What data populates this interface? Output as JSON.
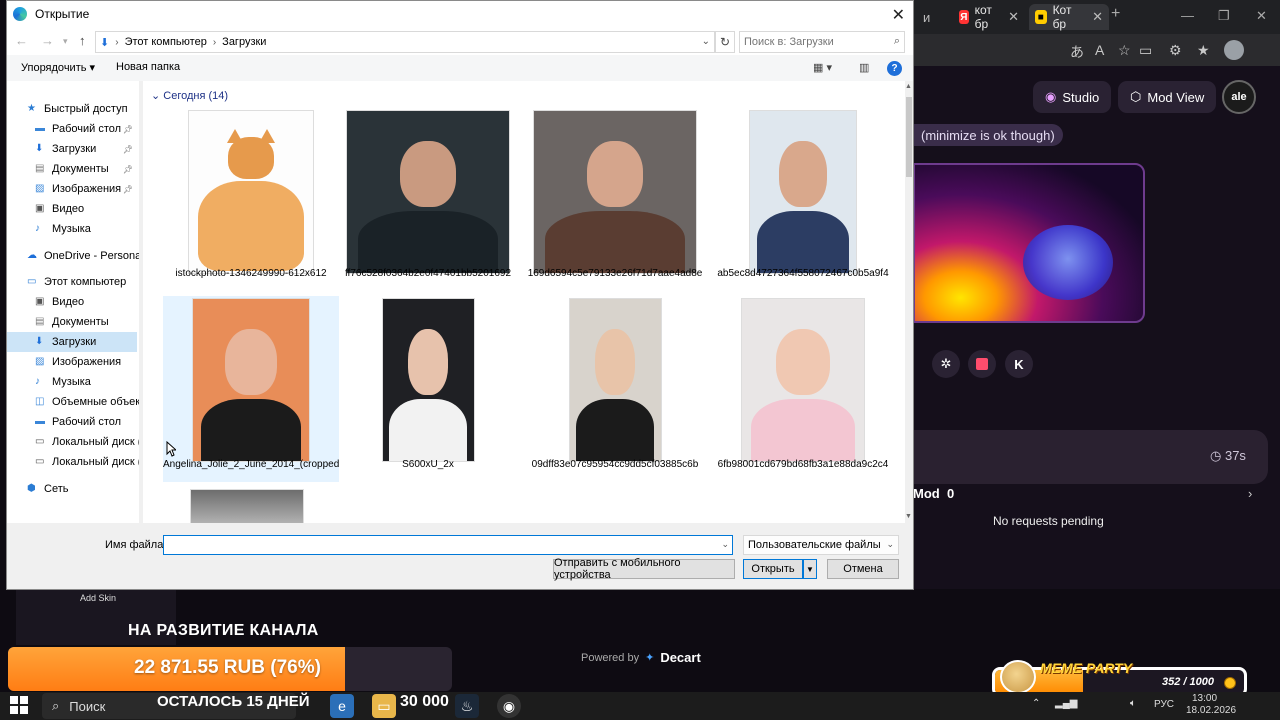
{
  "dialog": {
    "title": "Открытие",
    "breadcrumb": [
      "Этот компьютер",
      "Загрузки"
    ],
    "search_placeholder": "Поиск в: Загрузки",
    "toolbar": {
      "organize": "Упорядочить",
      "new_folder": "Новая папка"
    },
    "group_header": "Сегодня (14)",
    "sidebar": [
      {
        "label": "Быстрый доступ",
        "icon": "star-icon",
        "indent": 0
      },
      {
        "label": "Рабочий стол",
        "icon": "desktop-icon",
        "indent": 1,
        "pinned": true
      },
      {
        "label": "Загрузки",
        "icon": "download-icon",
        "indent": 1,
        "pinned": true
      },
      {
        "label": "Документы",
        "icon": "document-icon",
        "indent": 1,
        "pinned": true
      },
      {
        "label": "Изображения",
        "icon": "images-icon",
        "indent": 1,
        "pinned": true
      },
      {
        "label": "Видео",
        "icon": "video-icon",
        "indent": 1
      },
      {
        "label": "Музыка",
        "icon": "music-icon",
        "indent": 1
      },
      {
        "label": "OneDrive - Personal",
        "icon": "cloud-icon",
        "indent": 0
      },
      {
        "label": "Этот компьютер",
        "icon": "computer-icon",
        "indent": 0
      },
      {
        "label": "Видео",
        "icon": "video-icon",
        "indent": 1
      },
      {
        "label": "Документы",
        "icon": "document-icon",
        "indent": 1
      },
      {
        "label": "Загрузки",
        "icon": "download-icon",
        "indent": 1,
        "selected": true
      },
      {
        "label": "Изображения",
        "icon": "images-icon",
        "indent": 1
      },
      {
        "label": "Музыка",
        "icon": "music-icon",
        "indent": 1
      },
      {
        "label": "Объемные объекты",
        "icon": "cube-icon",
        "indent": 1
      },
      {
        "label": "Рабочий стол",
        "icon": "desktop-icon",
        "indent": 1
      },
      {
        "label": "Локальный диск (C",
        "icon": "drive-icon",
        "indent": 1
      },
      {
        "label": "Локальный диск (D",
        "icon": "drive-icon",
        "indent": 1
      },
      {
        "label": "Сеть",
        "icon": "network-icon",
        "indent": 0
      }
    ],
    "files": [
      {
        "name": "istockphoto-1346249990-612x612",
        "kind": "cat-photo"
      },
      {
        "name": "ff76c528f0364b2e0f47401bb5201692",
        "kind": "portrait-dark"
      },
      {
        "name": "169d6594c5e79133e26f71d7aae4ad8e",
        "kind": "portrait-brown"
      },
      {
        "name": "ab5ec8d4727364f558072467c0b5a9f4",
        "kind": "portrait-blue"
      },
      {
        "name": "Angelina_Jolie_2_June_2014_(cropped)",
        "kind": "portrait-orange",
        "selected": true
      },
      {
        "name": "S600xU_2x",
        "kind": "portrait-darkbg"
      },
      {
        "name": "09dff83e07c95954cc9dd5cf03885c6b",
        "kind": "portrait-blonde"
      },
      {
        "name": "6fb98001cd679bd68fb3a1e88da9c2c4",
        "kind": "portrait-light"
      }
    ],
    "filename_label": "Имя файла:",
    "filename_value": "",
    "filetype": "Пользовательские файлы",
    "mobile_button": "Отправить с мобильного устройства",
    "open_button": "Открыть",
    "cancel_button": "Отмена"
  },
  "browser": {
    "tabs": [
      "кот бр",
      "Кот бр"
    ],
    "pills": [
      "Studio",
      "Mod View"
    ],
    "logo_text": "ale",
    "chip_text": "minimize is ok though)",
    "timer": "37s",
    "mod_label": "Mod",
    "mod_count": "0",
    "no_requests": "No requests pending",
    "powered_by": "Powered by",
    "powered_brand": "Decart"
  },
  "overlay": {
    "add_skin": "Add Skin",
    "promo_title": "НА РАЗВИТИЕ КАНАЛА",
    "promo_amount": "22 871.55 RUB (76%)",
    "promo_progress": 0.76,
    "days_left": "ОСТАЛОСЬ 15 ДНЕЙ",
    "meme_title": "MEME PARTY",
    "meme_count": "352 / 1000",
    "meme_progress": 0.352
  },
  "taskbar": {
    "search": "Поиск",
    "counter": "30 000",
    "lang": "РУС",
    "time": "13:00",
    "date": "18.02.2026"
  }
}
